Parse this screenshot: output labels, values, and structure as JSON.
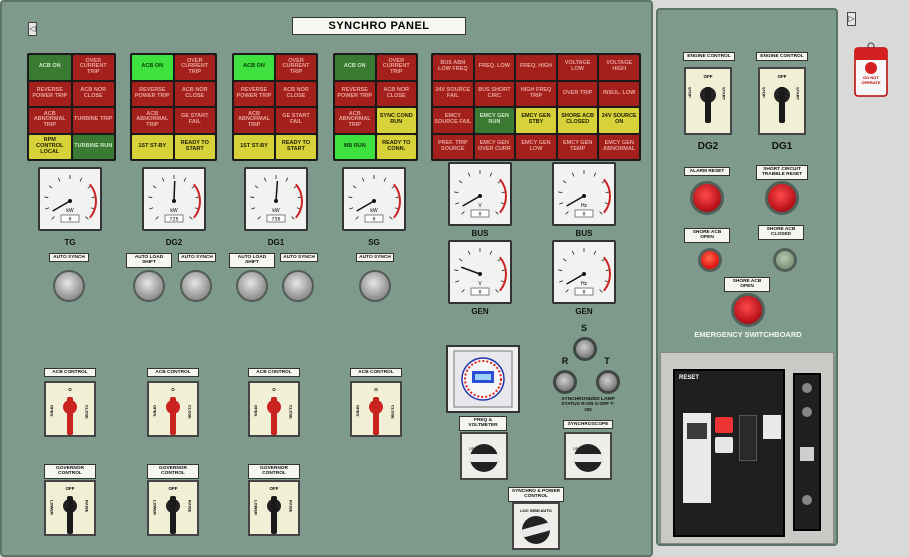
{
  "panel": {
    "title": "SYNCHRO PANEL",
    "nav_left": "◁",
    "nav_right": "▷"
  },
  "status_tg": [
    "ACB ON",
    "OVER CURRENT TRIP",
    "REVERSE POWER TRIP",
    "ACB NOR CLOSE",
    "ACB ABNORMAL TRIP",
    "TURBINE TRIP",
    "RPM CONTROL LOCAL",
    "TURBINE RUN"
  ],
  "status_dg2": [
    "ACB ON",
    "OVER CURRENT TRIP",
    "REVERSE POWER TRIP",
    "ACB NOR CLOSE",
    "ACB ABNORMAL TRIP",
    "GE START FAIL",
    "1ST ST-BY",
    "READY TO START"
  ],
  "status_dg1": [
    "ACB ON",
    "OVER CURRENT TRIP",
    "REVERSE POWER TRIP",
    "ACB NOR CLOSE",
    "ACB ABNORMAL TRIP",
    "GE START FAIL",
    "1ST ST-BY",
    "READY TO START"
  ],
  "status_sg": [
    "ACB ON",
    "OVER CURRENT TRIP",
    "REVERSE POWER TRIP",
    "ACB NOR CLOSE",
    "ACB ABNORMAL TRIP",
    "SYNC COND RUN",
    "MB RUN",
    "READY TO CONN."
  ],
  "status_bus": [
    "BUS ABN LOW FREQ",
    "FREQ. LOW",
    "FREQ. HIGH",
    "VOLTAGE LOW",
    "VOLTAGE HIGH",
    "24V SOURCE FAIL",
    "BUS SHORT CIRC",
    "HIGH FREQ TRIP",
    "OVER TRIP",
    "INSUL. LOW",
    "EMCY SOURCE FAIL",
    "EMCY GEN RUN",
    "EMCY GEN STBY",
    "SHORE ACB CLOSED",
    "24V SOURCE ON",
    "PREF. TRIP SOURCE",
    "EMCY GEN OVER CURR",
    "EMCY GEN LOW",
    "EMCY GEN TEMP",
    "EMCY GEN ABNORMAL"
  ],
  "gauges": {
    "tg": {
      "unit": "kW",
      "value": "0",
      "label": "TG"
    },
    "dg2": {
      "unit": "kW",
      "value": "725",
      "label": "DG2"
    },
    "dg1": {
      "unit": "kW",
      "value": "736",
      "label": "DG1"
    },
    "sg": {
      "unit": "kW",
      "value": "0",
      "label": "SG"
    },
    "bus_v": {
      "unit": "V",
      "value": "0",
      "label": "BUS"
    },
    "bus_hz": {
      "unit": "Hz",
      "value": "0",
      "label": "BUS"
    },
    "gen_v": {
      "unit": "V",
      "value": "0",
      "label": "GEN"
    },
    "gen_hz": {
      "unit": "Hz",
      "value": "0",
      "label": "GEN"
    }
  },
  "tags": {
    "auto_synch": "AUTO SYNCH",
    "auto_load_shift": "AUTO LOAD SHIFT",
    "acb_control": "ACB CONTROL",
    "governor_control": "GOVERNOR CONTROL",
    "freq_voltmeter": "FREQ & VOLTMETER",
    "synchroscope": "SYNCHROSCOPE",
    "sync_power_control": "SYNCHRO & POWER CONTROL",
    "sync_lamp": "SYNCHRONIZED LAMP STATUS R-ON S-OFF T-ON",
    "engine_control": "ENGINE CONTROL",
    "alarm_reset": "ALARM RESET",
    "short_circuit_reset": "SHORT CIRCUIT TRABBLE RESET",
    "shore_acb_open": "SHORE ACB OPEN",
    "shore_acb_closed": "SHORE ACB CLOSED",
    "shore_acb_open2": "SHORE ACB OPEN",
    "emergency_switchboard": "EMERGENCY SWITCHBOARD",
    "do_not_operate": "DO NOT OPERATE"
  },
  "switch_text": {
    "open": "OPEN",
    "close": "CLOSE",
    "o": "O",
    "off": "OFF",
    "lower": "LOWER",
    "raise": "RAISE",
    "stop": "STOP",
    "start": "START",
    "on": "ON",
    "sel": "LOC SEMI AUTO"
  },
  "lamps": {
    "r": "R",
    "s": "S",
    "t": "T"
  },
  "engine_labels": {
    "dg2": "DG2",
    "dg1": "DG1"
  },
  "breaker": {
    "reset": "RESET"
  },
  "colors": {
    "panel": "#7e9a8c",
    "red_lamp": "#a3201c",
    "green_lamp": "#3a7a32",
    "bright_green": "#3ee13e",
    "yellow_lamp": "#d7d13a"
  }
}
